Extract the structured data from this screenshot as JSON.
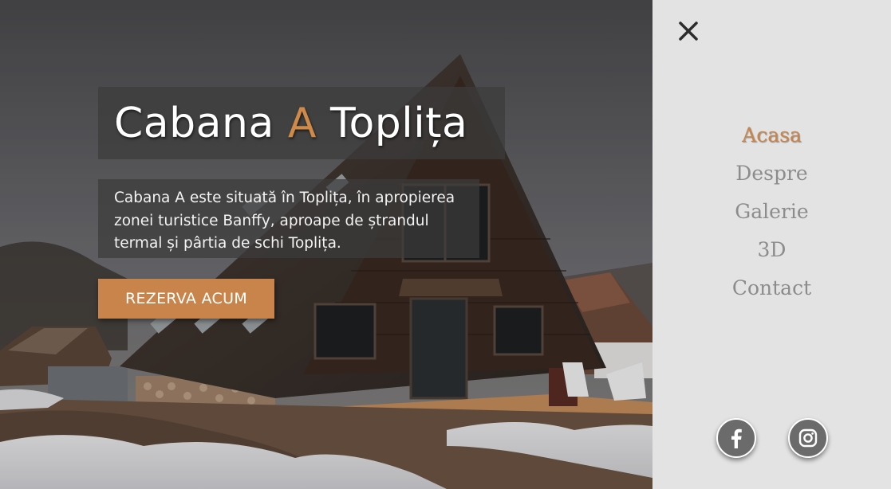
{
  "hero": {
    "title_part1": "Cabana ",
    "title_accent": "A",
    "title_part2": " Toplița",
    "description": "Cabana A este situată în Toplița, în apropierea zonei turistice Banffy, aproape de ștrandul termal și pârtia de schi Toplița.",
    "cta_label": "REZERVA ACUM",
    "image_icon": "a-frame-cabin-photo"
  },
  "menu": {
    "close_icon": "close-icon",
    "items": [
      {
        "label": "Acasa",
        "active": true
      },
      {
        "label": "Despre",
        "active": false
      },
      {
        "label": "Galerie",
        "active": false
      },
      {
        "label": "3D",
        "active": false
      },
      {
        "label": "Contact",
        "active": false
      }
    ],
    "social": [
      {
        "name": "facebook",
        "icon": "facebook-icon"
      },
      {
        "name": "instagram",
        "icon": "instagram-icon"
      }
    ]
  },
  "colors": {
    "accent": "#c8844a",
    "menu_bg": "#e3e3e3",
    "menu_text": "#8c8c8c",
    "overlay": "rgba(60,60,60,0.72)"
  }
}
